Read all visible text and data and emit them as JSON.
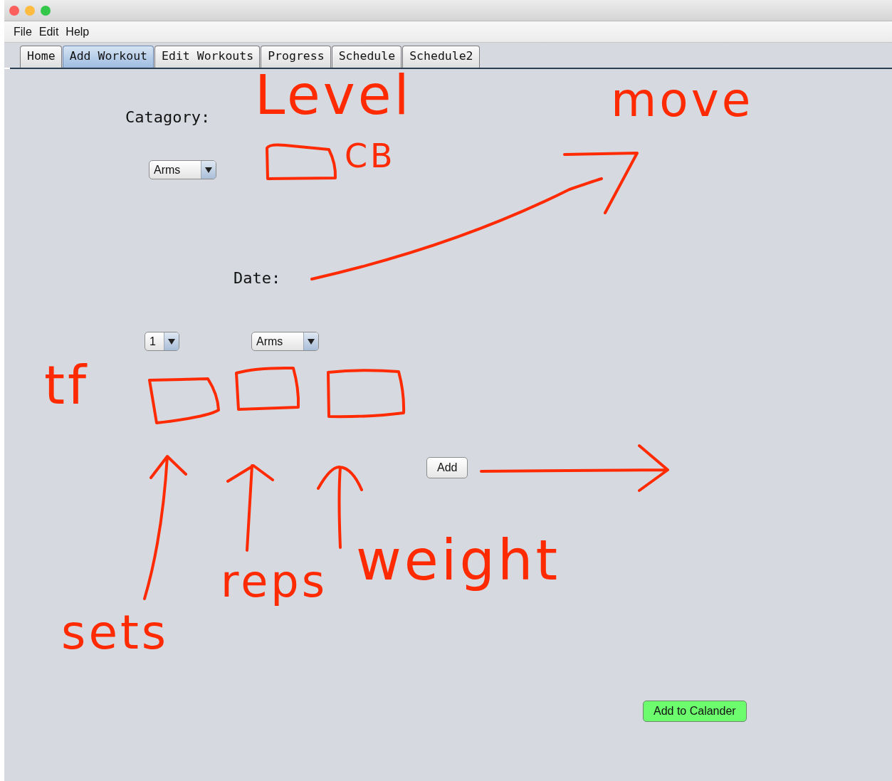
{
  "menu": [
    {
      "label": "File"
    },
    {
      "label": "Edit"
    },
    {
      "label": "Help"
    }
  ],
  "tabs": [
    {
      "label": "Home",
      "selected": false
    },
    {
      "label": "Add Workout",
      "selected": true
    },
    {
      "label": "Edit Workouts",
      "selected": false
    },
    {
      "label": "Progress",
      "selected": false
    },
    {
      "label": "Schedule",
      "selected": false
    },
    {
      "label": "Schedule2",
      "selected": false
    }
  ],
  "form": {
    "category_label": "Catagory:",
    "category_combo": "Arms",
    "date_label": "Date:",
    "sets_combo": "1",
    "type_combo": "Arms",
    "add_button": "Add",
    "calendar_button": "Add to Calander"
  },
  "annotations": [
    {
      "text": "Level"
    },
    {
      "text": "move"
    },
    {
      "text": "CB"
    },
    {
      "text": "tf"
    },
    {
      "text": "reps"
    },
    {
      "text": "weight"
    },
    {
      "text": "sets"
    }
  ]
}
